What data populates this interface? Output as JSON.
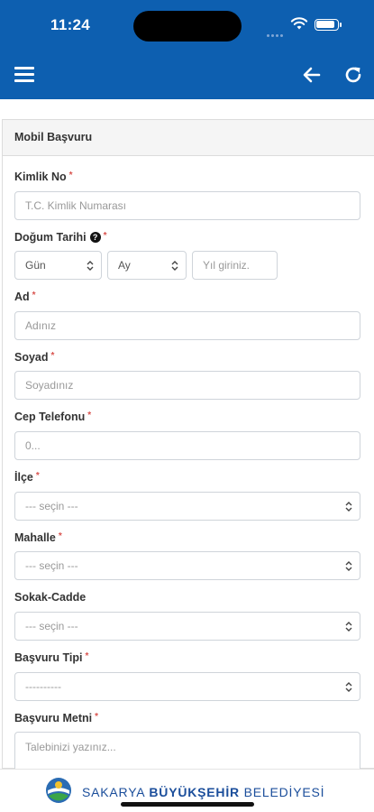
{
  "status": {
    "time": "11:24"
  },
  "app_bar": {
    "menu_icon": "hamburger-menu-icon",
    "back_icon": "arrow-left-icon",
    "refresh_icon": "refresh-icon",
    "color": "#0d5fb0"
  },
  "form": {
    "title": "Mobil Başvuru",
    "required_mark": "*",
    "kimlik": {
      "label": "Kimlik No",
      "placeholder": "T.C. Kimlik Numarası"
    },
    "dogum": {
      "label": "Doğum Tarihi",
      "help": "?",
      "day": "Gün",
      "month": "Ay",
      "year_placeholder": "Yıl giriniz."
    },
    "ad": {
      "label": "Ad",
      "placeholder": "Adınız"
    },
    "soyad": {
      "label": "Soyad",
      "placeholder": "Soyadınız"
    },
    "telefon": {
      "label": "Cep Telefonu",
      "placeholder": "0..."
    },
    "ilce": {
      "label": "İlçe",
      "value": "--- seçin ---"
    },
    "mahalle": {
      "label": "Mahalle",
      "value": "--- seçin ---"
    },
    "sokak": {
      "label": "Sokak-Cadde",
      "value": "--- seçin ---"
    },
    "tip": {
      "label": "Başvuru Tipi",
      "value": "----------"
    },
    "metin": {
      "label": "Başvuru Metni",
      "placeholder": "Talebinizi yazınız..."
    }
  },
  "footer": {
    "brand_1": "SAKARYA ",
    "brand_2": "BÜYÜKŞEHİR",
    "brand_3": " BELEDİYESİ",
    "logo_icon": "municipality-logo-icon"
  }
}
